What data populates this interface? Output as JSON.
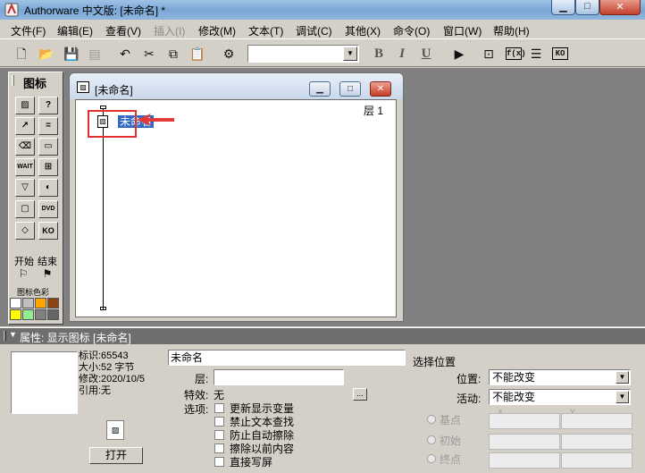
{
  "window": {
    "title": "Authorware 中文版: [未命名] *"
  },
  "menu": [
    "文件(F)",
    "编辑(E)",
    "查看(V)",
    "插入(I)",
    "修改(M)",
    "文本(T)",
    "调试(C)",
    "其他(X)",
    "命令(O)",
    "窗口(W)",
    "帮助(H)"
  ],
  "toolbar": {
    "icons": [
      "new-icon",
      "open-icon",
      "save-all-icon",
      "import-icon",
      "undo-icon",
      "cut-icon",
      "copy-icon",
      "paste-icon",
      "find-icon",
      "run-icon",
      "control-panel-icon",
      "functions-icon",
      "variables-icon",
      "knowledge-objects-icon"
    ],
    "bold": "B",
    "italic": "I",
    "underline": "U",
    "functions": "f(x)",
    "knowledge_objects": "KO"
  },
  "palette": {
    "title": "图标",
    "start_label": "开始",
    "end_label": "结束",
    "color_label": "图标色彩",
    "wait_label": "WAIT",
    "ko_label": "KO",
    "dvd_label": "DVD",
    "colors": [
      "#ffffff",
      "#c0c0c0",
      "#ffa500",
      "#8b4513",
      "#ffff00",
      "#90ee90",
      "#808080",
      "#666666"
    ]
  },
  "design_window": {
    "title": "[未命名]",
    "layer": "层 1",
    "icon_label": "未命名"
  },
  "properties": {
    "header": "属性: 显示图标 [未命名]",
    "info": {
      "id": "标识:65543",
      "size": "大小:52 字节",
      "modified": "修改:2020/10/5",
      "ref": "引用:无"
    },
    "open_button": "打开",
    "name_value": "未命名",
    "layer_label": "层:",
    "effect_label": "特效:",
    "effect_value": "无",
    "effect_button": "...",
    "options_label": "选项:",
    "options": [
      "更新显示变量",
      "禁止文本查找",
      "防止自动擦除",
      "擦除以前内容",
      "直接写屏"
    ],
    "position_group": "选择位置",
    "position_label": "位置:",
    "position_value": "不能改变",
    "active_label": "活动:",
    "active_value": "不能改变",
    "radios": [
      "基点",
      "初始",
      "终点"
    ],
    "x_label": "X",
    "y_label": "Y"
  }
}
